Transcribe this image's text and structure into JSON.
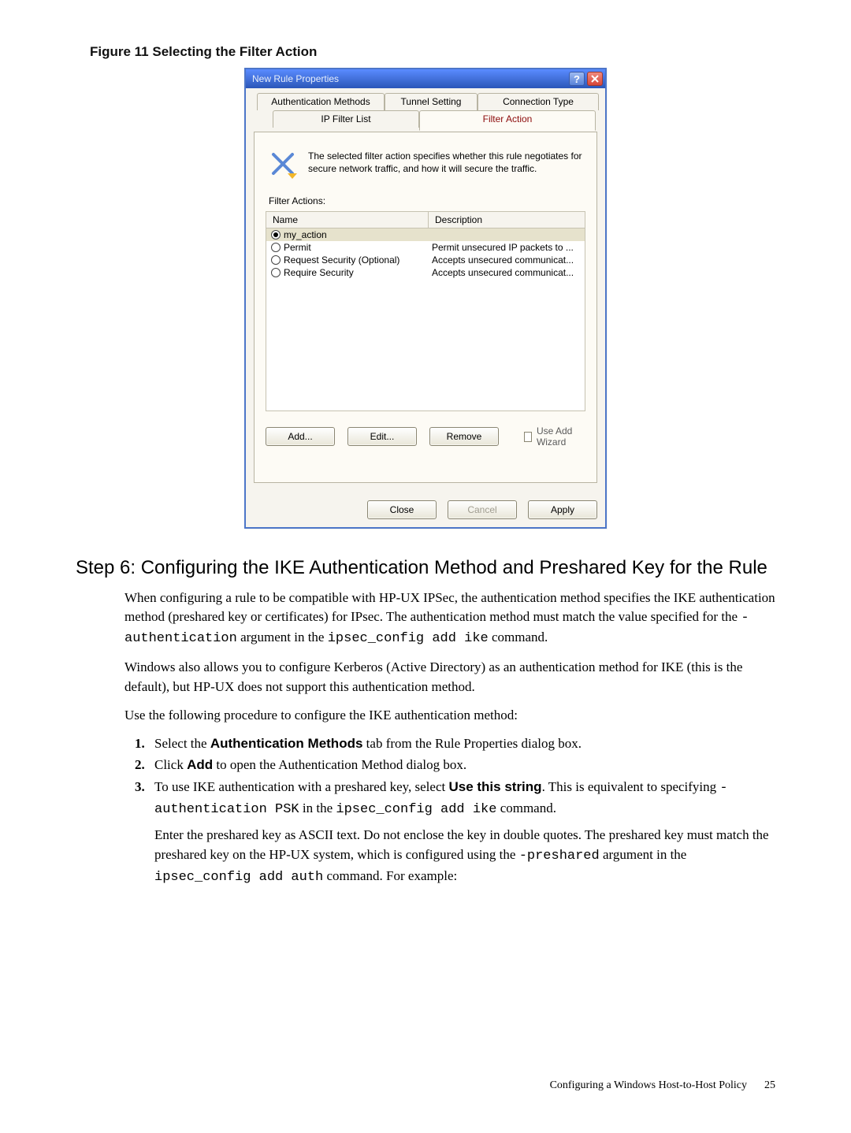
{
  "figure_caption": "Figure 11 Selecting the Filter Action",
  "dialog": {
    "title": "New Rule Properties",
    "tabs": {
      "auth": "Authentication Methods",
      "tunnel": "Tunnel Setting",
      "conn": "Connection Type",
      "iplist": "IP Filter List",
      "faction": "Filter Action"
    },
    "msg": "The selected filter action specifies whether this rule negotiates for secure network traffic, and how it will secure the traffic.",
    "fa_label": "Filter Actions:",
    "cols": {
      "name": "Name",
      "desc": "Description"
    },
    "rows": [
      {
        "label": "my_action",
        "desc": "",
        "selected": true
      },
      {
        "label": "Permit",
        "desc": "Permit unsecured IP packets to ...",
        "selected": false
      },
      {
        "label": "Request Security (Optional)",
        "desc": "Accepts unsecured communicat...",
        "selected": false
      },
      {
        "label": "Require Security",
        "desc": "Accepts unsecured communicat...",
        "selected": false
      }
    ],
    "buttons": {
      "add": "Add...",
      "edit": "Edit...",
      "remove": "Remove",
      "wizard": "Use Add Wizard",
      "close": "Close",
      "cancel": "Cancel",
      "apply": "Apply"
    }
  },
  "step_heading": "Step 6: Configuring the IKE Authentication Method and Preshared Key for the Rule",
  "body": {
    "p1a": "When configuring a rule to be compatible with HP-UX IPSec, the authentication method specifies the IKE authentication method (preshared key or certificates) for IPsec. The authentication method must match the value specified for the ",
    "p1code1": "-authentication",
    "p1b": " argument in the ",
    "p1code2": "ipsec_config add ike",
    "p1c": " command.",
    "p2": "Windows also allows you to configure Kerberos (Active Directory) as an authentication method for IKE (this is the default), but HP-UX does not support this authentication method.",
    "p3": "Use the following procedure to configure the IKE authentication method:",
    "li1a": "Select the ",
    "li1b": "Authentication Methods",
    "li1c": " tab from the Rule Properties dialog box.",
    "li2a": "Click ",
    "li2b": "Add",
    "li2c": " to open the Authentication Method dialog box.",
    "li3a": "To use IKE authentication with a preshared key, select ",
    "li3b": "Use this string",
    "li3c": ". This is equivalent to specifying ",
    "li3code1": "-authentication PSK",
    "li3d": " in the ",
    "li3code2": "ipsec_config add ike",
    "li3e": " command.",
    "li3sub_a": "Enter the preshared key as ASCII text. Do not enclose the key in double quotes. The preshared key must match the preshared key on the HP-UX system, which is configured using the ",
    "li3sub_code1": "-preshared",
    "li3sub_b": " argument in the ",
    "li3sub_code2": "ipsec_config add auth",
    "li3sub_c": " command. For example:"
  },
  "footer": {
    "section": "Configuring a Windows Host-to-Host Policy",
    "page": "25"
  },
  "chart_data": {
    "type": "table",
    "notes": "Filter Actions list shown in dialog; 'my_action' is selected via radio button.",
    "columns": [
      "Name",
      "Description"
    ],
    "rows": [
      [
        "my_action",
        ""
      ],
      [
        "Permit",
        "Permit unsecured IP packets to ..."
      ],
      [
        "Request Security (Optional)",
        "Accepts unsecured communicat..."
      ],
      [
        "Require Security",
        "Accepts unsecured communicat..."
      ]
    ]
  }
}
